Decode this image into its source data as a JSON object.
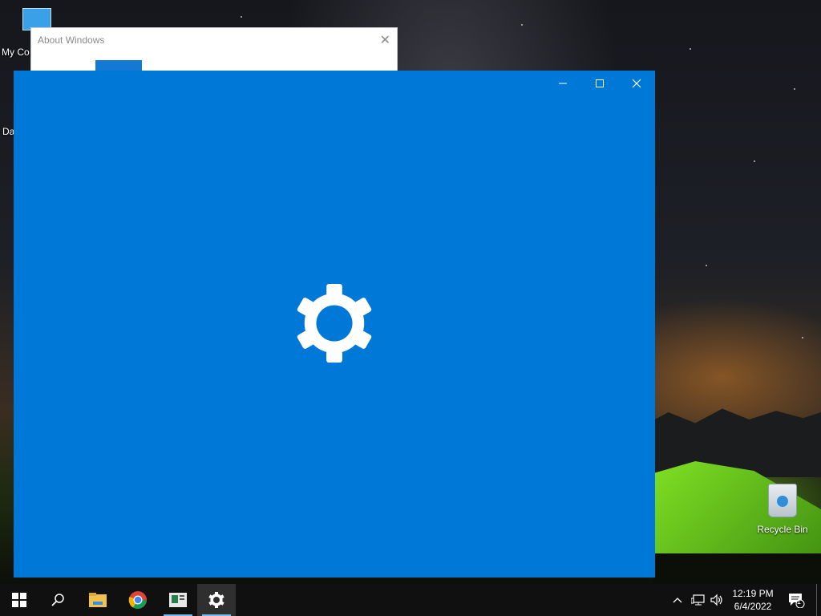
{
  "desktop": {
    "icons": [
      {
        "label": "My Co"
      },
      {
        "label": "Da"
      },
      {
        "label": "Recycle Bin"
      }
    ]
  },
  "about_window": {
    "title": "About Windows",
    "close": "✕"
  },
  "settings_window": {
    "accent_color": "#0078d7",
    "minimize": "—",
    "maximize": "☐",
    "close": "✕",
    "center_icon": "gear-icon"
  },
  "taskbar": {
    "items": [
      {
        "name": "start",
        "icon": "windows-logo-icon"
      },
      {
        "name": "search",
        "icon": "search-icon"
      },
      {
        "name": "file-explorer",
        "icon": "folder-icon"
      },
      {
        "name": "chrome",
        "icon": "chrome-icon"
      },
      {
        "name": "news",
        "icon": "news-icon"
      },
      {
        "name": "settings",
        "icon": "gear-icon",
        "active": true
      }
    ],
    "tray": {
      "chevron": "^",
      "time": "12:19 PM",
      "date": "6/4/2022",
      "notification_count": "1"
    }
  }
}
